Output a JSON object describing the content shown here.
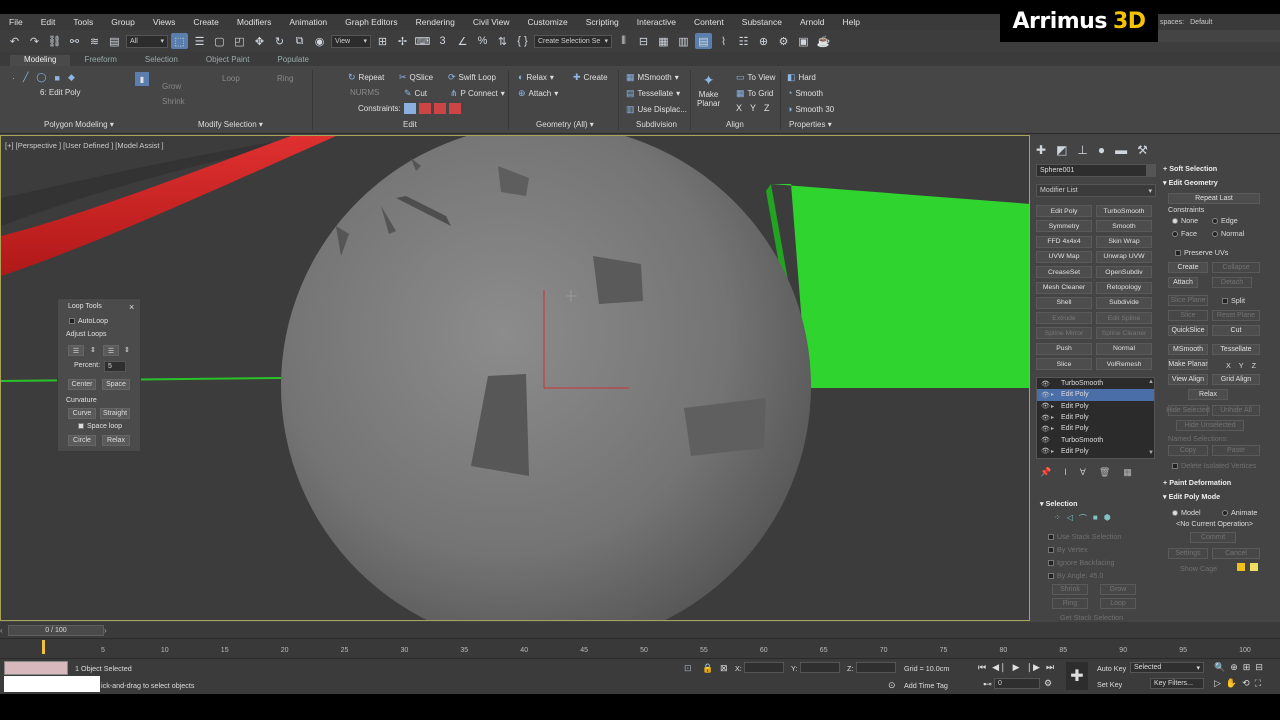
{
  "menubar": [
    "File",
    "Edit",
    "Tools",
    "Group",
    "Views",
    "Create",
    "Modifiers",
    "Animation",
    "Graph Editors",
    "Rendering",
    "Civil View",
    "Customize",
    "Scripting",
    "Interactive",
    "Content",
    "Substance",
    "Arnold",
    "Help"
  ],
  "logo": {
    "text": "Arrimus",
    "accent": "3D"
  },
  "workspaces": {
    "label": "spaces:",
    "value": "Default"
  },
  "toolbar": {
    "filter": "All",
    "refcoord": "View",
    "selection_set": "Create Selection Se"
  },
  "ribbon": {
    "tabs": [
      "Modeling",
      "Freeform",
      "Selection",
      "Object Paint",
      "Populate"
    ],
    "active_tab": "Modeling",
    "edit_poly_label": "6: Edit Poly",
    "sub_labels": [
      "Grow",
      "Shrink",
      "Loop",
      "Ring"
    ],
    "edit_group": {
      "repeat": "Repeat",
      "qslice": "QSlice",
      "swift_loop": "Swift Loop",
      "nurms": "NURMS",
      "cut": "Cut",
      "p_connect": "P Connect",
      "constraints": "Constraints:"
    },
    "geometry_group": {
      "relax": "Relax",
      "create": "Create",
      "attach": "Attach"
    },
    "subdivision_group": {
      "msmooth": "MSmooth",
      "tessellate": "Tessellate",
      "use_displac": "Use Displac..."
    },
    "align_group": {
      "make_planar": "Make\nPlanar",
      "to_view": "To View",
      "to_grid": "To Grid",
      "x": "X",
      "y": "Y",
      "z": "Z"
    },
    "properties_group": {
      "hard": "Hard",
      "smooth": "Smooth",
      "smooth30": "Smooth 30"
    },
    "footer": [
      "Polygon Modeling",
      "Modify Selection",
      "Edit",
      "Geometry (All)",
      "Subdivision",
      "Align",
      "Properties"
    ]
  },
  "viewport": {
    "label": "[+] [Perspective ] [User Defined ] [Model Assist ]"
  },
  "loop_tools": {
    "title": "Loop Tools",
    "autoloop": "AutoLoop",
    "adjust_loops": "Adjust Loops",
    "percent_label": "Percent:",
    "percent_value": "5",
    "center": "Center",
    "space": "Space",
    "curvature": "Curvature",
    "curve": "Curve",
    "straight": "Straight",
    "space_loop": "Space loop",
    "circle": "Circle",
    "relax": "Relax"
  },
  "command_panel": {
    "object_name": "Sphere001",
    "modifier_list": "Modifier List",
    "modifier_buttons": [
      [
        "Edit Poly",
        "TurboSmooth"
      ],
      [
        "Symmetry",
        "Smooth"
      ],
      [
        "FFD 4x4x4",
        "Skin Wrap"
      ],
      [
        "UVW Map",
        "Unwrap UVW"
      ],
      [
        "CreaseSet",
        "OpenSubdiv"
      ],
      [
        "Mesh Cleaner",
        "Retopology"
      ],
      [
        "Shell",
        "Subdivide"
      ],
      [
        "Extrude",
        "Edit Spline"
      ],
      [
        "Spline Mirror",
        "Spline Cleaner"
      ],
      [
        "Push",
        "Normal"
      ],
      [
        "Slice",
        "VolRemesh"
      ]
    ],
    "stack": [
      "TurboSmooth",
      "Edit Poly",
      "Edit Poly",
      "Edit Poly",
      "Edit Poly",
      "TurboSmooth",
      "Edit Poly"
    ],
    "stack_selected_index": 1,
    "selection_rollout": {
      "title": "Selection",
      "use_stack": "Use Stack Selection",
      "by_vertex": "By Vertex",
      "ignore_backfacing": "Ignore Backfacing",
      "by_angle": "By Angle:",
      "by_angle_val": "45.0",
      "shrink": "Shrink",
      "grow": "Grow",
      "ring": "Ring",
      "loop": "Loop",
      "get_stack": "Get Stack Selection"
    }
  },
  "right_rollouts": {
    "soft_selection": "Soft Selection",
    "edit_geometry": "Edit Geometry",
    "repeat_last": "Repeat Last",
    "constraints": "Constraints",
    "none": "None",
    "edge": "Edge",
    "face": "Face",
    "normal": "Normal",
    "preserve_uvs": "Preserve UVs",
    "create": "Create",
    "collapse": "Collapse",
    "attach": "Attach",
    "detach": "Detach",
    "slice_plane": "Slice Plane",
    "split": "Split",
    "slice": "Slice",
    "reset_plane": "Reset Plane",
    "quickslice": "QuickSlice",
    "cut": "Cut",
    "msmooth": "MSmooth",
    "tessellate": "Tessellate",
    "make_planar": "Make Planar",
    "x": "X",
    "y": "Y",
    "z": "Z",
    "view_align": "View Align",
    "grid_align": "Grid Align",
    "relax": "Relax",
    "hide_selected": "Hide Selected",
    "unhide_all": "Unhide All",
    "hide_unselected": "Hide Unselected",
    "named_selections": "Named Selections:",
    "copy": "Copy",
    "paste": "Paste",
    "delete_isolated": "Delete Isolated Vertices",
    "paint_deformation": "Paint Deformation",
    "edit_poly_mode": "Edit Poly Mode",
    "model": "Model",
    "animate": "Animate",
    "no_op": "<No Current Operation>",
    "commit": "Commit",
    "settings": "Settings",
    "cancel": "Cancel",
    "show_cage": "Show Cage"
  },
  "timeline": {
    "slider": "0 / 100",
    "ticks": [
      "5",
      "10",
      "15",
      "20",
      "25",
      "30",
      "35",
      "40",
      "45",
      "50",
      "55",
      "60",
      "65",
      "70",
      "75",
      "80",
      "85",
      "90",
      "95",
      "100"
    ]
  },
  "status": {
    "objects_selected": "1 Object Selected",
    "prompt": "ick-and-drag to select objects",
    "x_label": "X:",
    "y_label": "Y:",
    "z_label": "Z:",
    "grid": "Grid = 10.0cm",
    "add_time_tag": "Add Time Tag",
    "auto_key": "Auto Key",
    "set_key": "Set Key",
    "selected": "Selected",
    "key_filters": "Key Filters...",
    "frame": "0"
  }
}
